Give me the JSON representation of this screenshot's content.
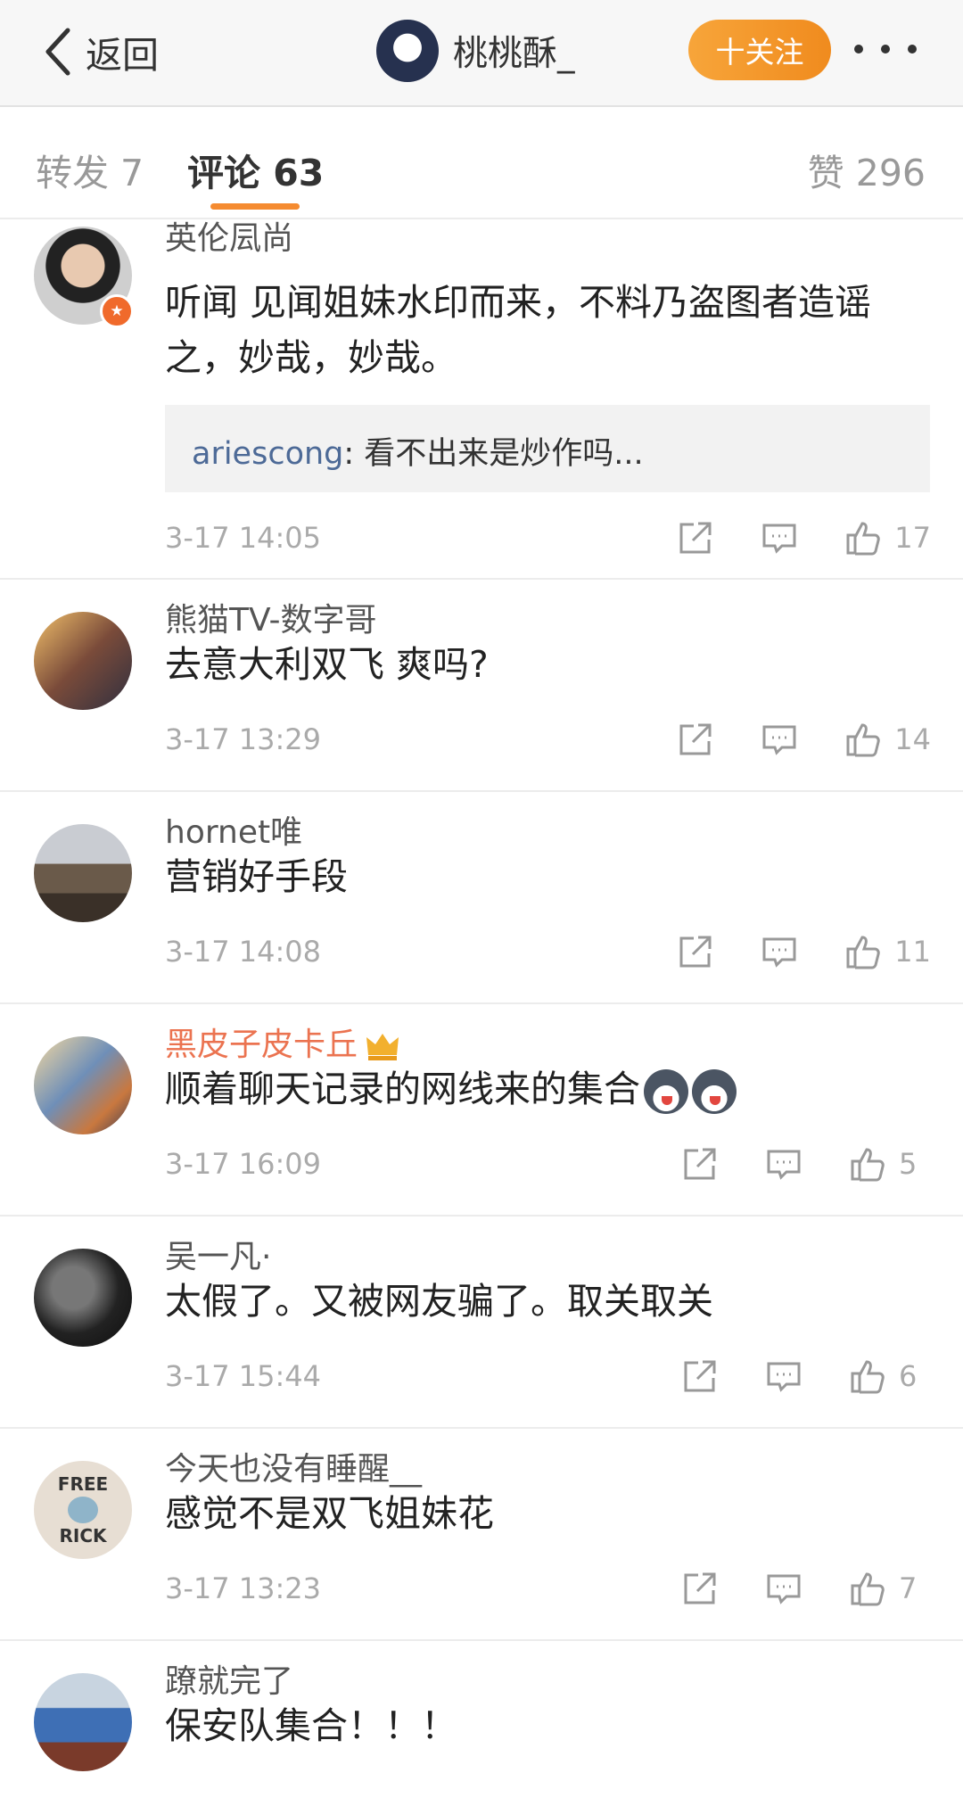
{
  "nav": {
    "back_label": "返回",
    "username": "桃桃酥_",
    "follow_label": "十关注"
  },
  "tabs": {
    "repost": "转发 7",
    "comment": "评论 63",
    "like": "赞 296"
  },
  "comments": [
    {
      "user": "英伦凨尚",
      "text": "听闻 见闻姐妹水印而来，不料乃盗图者造谣之，妙哉，妙哉。",
      "reply_user": "ariescong",
      "reply_text": ": 看不出来是炒作吗...",
      "time": "3-17 14:05",
      "likes": "17"
    },
    {
      "user": "熊猫TV-数字哥",
      "text": "去意大利双飞 爽吗?",
      "time": "3-17 13:29",
      "likes": "14"
    },
    {
      "user": "hornet唯",
      "text": "营销好手段",
      "time": "3-17 14:08",
      "likes": "11"
    },
    {
      "user": "黑皮子皮卡丘",
      "text": "顺着聊天记录的网线来的集合",
      "time": "3-17 16:09",
      "likes": "5"
    },
    {
      "user": "吴一凡·",
      "text": "太假了。又被网友骗了。取关取关",
      "time": "3-17 15:44",
      "likes": "6"
    },
    {
      "user": "今天也没有睡醒__",
      "text": "感觉不是双飞姐妹花",
      "time": "3-17 13:23",
      "likes": "7"
    },
    {
      "user": "蹽就完了",
      "text": "保安队集合！！！"
    }
  ],
  "avatar_texts": {
    "free": "FREE",
    "rick": "RICK"
  },
  "colors": {
    "accent": "#f58b30",
    "vip_name": "#eb7350",
    "reply_user": "#4d6a97"
  }
}
